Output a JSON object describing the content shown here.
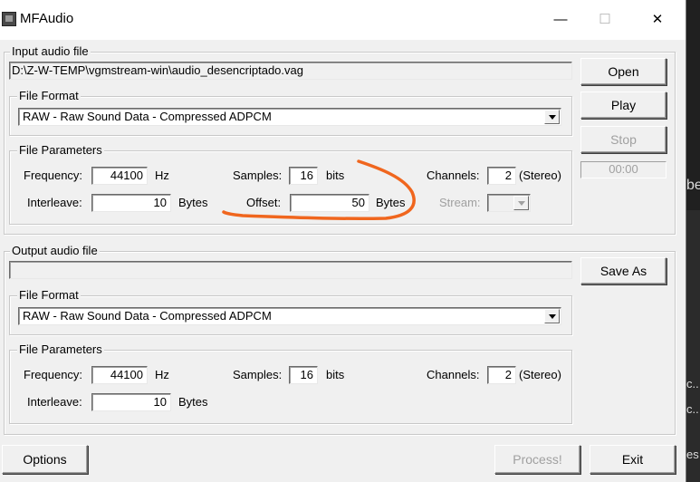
{
  "window": {
    "title": "MFAudio",
    "minimize": "—",
    "maximize": "☐",
    "close": "✕"
  },
  "input": {
    "group_label": "Input audio file",
    "path": "D:\\Z-W-TEMP\\vgmstream-win\\audio_desencriptado.vag",
    "file_format_label": "File Format",
    "file_format_value": "RAW - Raw Sound Data - Compressed ADPCM",
    "params_label": "File Parameters",
    "frequency_label": "Frequency:",
    "frequency_value": "44100",
    "hz": "Hz",
    "samples_label": "Samples:",
    "samples_value": "16",
    "bits": "bits",
    "channels_label": "Channels:",
    "channels_value": "2",
    "stereo": "(Stereo)",
    "interleave_label": "Interleave:",
    "interleave_value": "10",
    "bytes1": "Bytes",
    "offset_label": "Offset:",
    "offset_value": "50",
    "bytes2": "Bytes",
    "stream_label": "Stream:"
  },
  "side_buttons": {
    "open": "Open",
    "play": "Play",
    "stop": "Stop",
    "timer": "00:00"
  },
  "output": {
    "group_label": "Output audio file",
    "path": "",
    "save_as": "Save As",
    "file_format_label": "File Format",
    "file_format_value": "RAW - Raw Sound Data - Compressed ADPCM",
    "params_label": "File Parameters",
    "frequency_label": "Frequency:",
    "frequency_value": "44100",
    "hz": "Hz",
    "samples_label": "Samples:",
    "samples_value": "16",
    "bits": "bits",
    "channels_label": "Channels:",
    "channels_value": "2",
    "stereo": "(Stereo)",
    "interleave_label": "Interleave:",
    "interleave_value": "10",
    "bytes": "Bytes"
  },
  "bottom": {
    "options": "Options",
    "process": "Process!",
    "exit": "Exit"
  },
  "background_fragments": {
    "a": "be",
    "b": "c..",
    "c": "c..",
    "d": "es"
  },
  "colors": {
    "annotation": "#f0661e",
    "dialog_bg": "#f0f0f0",
    "background_dark": "#1c1c1c"
  },
  "icons": [
    "app-icon",
    "dropdown-arrow-icon"
  ]
}
